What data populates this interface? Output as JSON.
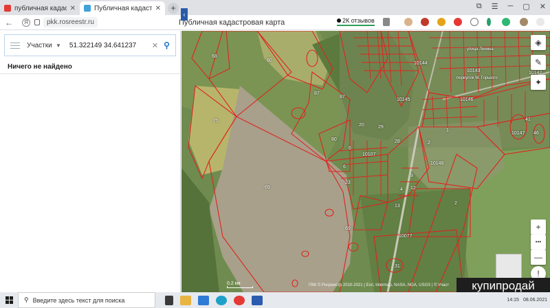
{
  "browser": {
    "tabs": [
      {
        "title": "публичная кадастровая к",
        "active": false,
        "favicon_color": "#e53935"
      },
      {
        "title": "Публичная кадастровая",
        "active": true,
        "favicon_color": "#3fa2d8"
      }
    ],
    "new_tab_label": "+",
    "url": "pkk.rosreestr.ru",
    "page_title": "Публичная кадастровая карта",
    "reviews_label": "2К отзывов"
  },
  "search": {
    "type_label": "Участки",
    "query": "51.322149 34.641237",
    "result_text": "Ничего не найдено"
  },
  "map": {
    "labels": {
      "l68": "68",
      "l80": "80",
      "l87a": "87",
      "l87b": "87",
      "l75": "75",
      "l80b": "80",
      "l69a": "69",
      "l69b": "69",
      "l29": "29",
      "l20": "20",
      "l28": "28",
      "l6": "6",
      "l23": "23",
      "l9": "9",
      "l4": "4",
      "l12": "12",
      "l2": "2",
      "l1": "1",
      "l13": "13",
      "l31": "31",
      "l41": "41",
      "l46": "46",
      "l10144": "10144",
      "l10143": "10143",
      "l10146": "10146",
      "l10145": "10145",
      "l10147": "10147",
      "l10148": "10148",
      "l10142": "10142",
      "l10107": "10107",
      "l10077": "10077",
      "street1": "улица Ленина",
      "street2": "переулок М. Горького"
    },
    "scale_label": "0.2 км",
    "attribution": "ПКК © Росреестр 2010-2021 | Esri, Intermap, NASA, NGA, USGS | © Участ",
    "watermark": "купипродай",
    "controls": {
      "layers": "layers-icon",
      "ruler": "ruler-icon",
      "locate": "compass-icon",
      "zoom_in": "+",
      "more": "•••",
      "zoom_out": "—",
      "info": "!"
    }
  },
  "taskbar": {
    "search_placeholder": "Введите здесь текст для поиска",
    "time": "14:15",
    "date": "08.06.2021"
  }
}
